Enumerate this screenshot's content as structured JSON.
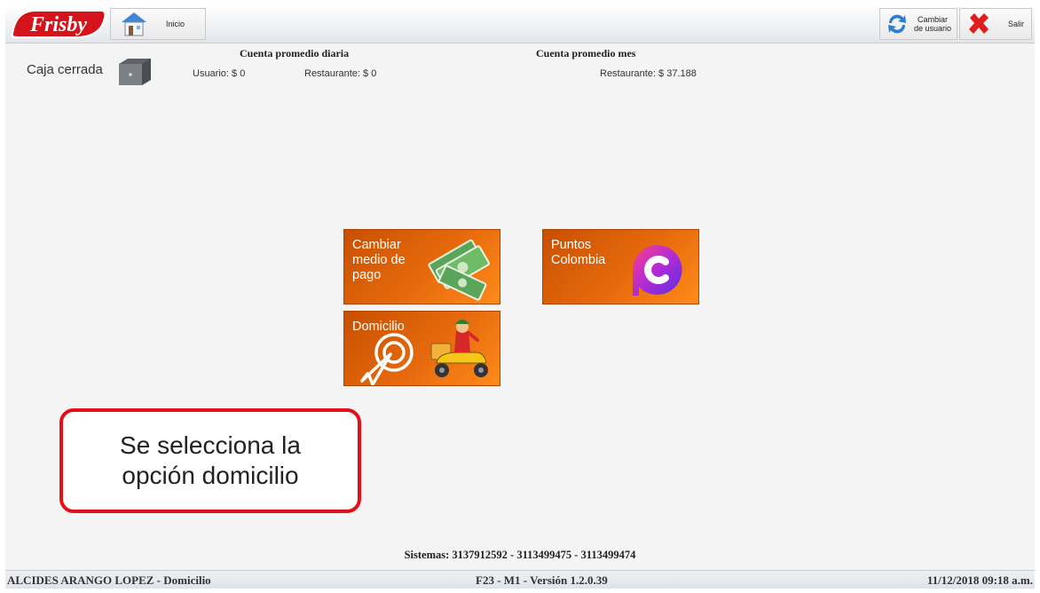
{
  "toolbar": {
    "brand": "Frisby",
    "home_label": "Inicio",
    "change_user_label": "Cambiar de usuario",
    "exit_label": "Salir"
  },
  "header": {
    "daily_title": "Cuenta promedio diaria",
    "daily_user": "Usuario: $ 0",
    "daily_restaurant": "Restaurante: $ 0",
    "monthly_title": "Cuenta promedio mes",
    "monthly_restaurant": "Restaurante: $ 37.188",
    "cash_status": "Caja cerrada"
  },
  "tiles": [
    {
      "label": "Cambiar\nmedio de\npago",
      "icon": "money-icon"
    },
    {
      "label": "Puntos\nColombia",
      "icon": "puntos-colombia-logo"
    },
    {
      "label": "Domicilio",
      "icon": "delivery-scooter-icon"
    }
  ],
  "callout": {
    "text": "Se selecciona la\nopción domicilio"
  },
  "footer": {
    "systems": "Sistemas: 3137912592 - 3113499475 - 3113499474",
    "user": "ALCIDES  ARANGO LOPEZ - Domicilio",
    "version": "F23 - M1  -  Versión 1.2.0.39",
    "datetime": "11/12/2018 09:18 a.m."
  },
  "colors": {
    "accent": "#e66a0c",
    "callout_border": "#e3101a",
    "brand_red": "#d4131b"
  }
}
